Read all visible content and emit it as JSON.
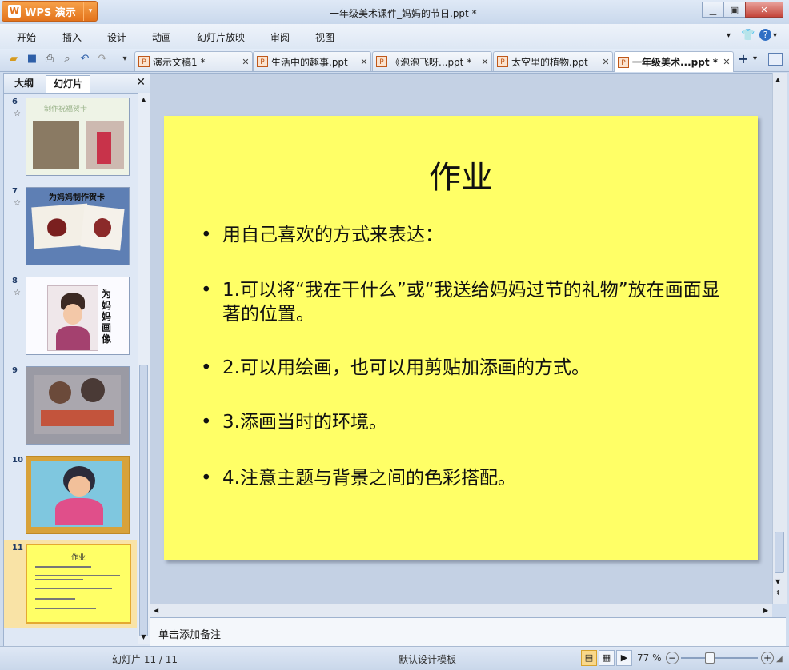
{
  "app": {
    "name": "WPS 演示",
    "doc_title": "一年级美术课件_妈妈的节日.ppt *"
  },
  "menu": [
    "开始",
    "插入",
    "设计",
    "动画",
    "幻灯片放映",
    "审阅",
    "视图"
  ],
  "tabs": [
    {
      "label": "演示文稿1 *"
    },
    {
      "label": "生活中的趣事.ppt"
    },
    {
      "label": "《泡泡飞呀...ppt *"
    },
    {
      "label": "太空里的植物.ppt"
    },
    {
      "label": "一年级美术...ppt *"
    }
  ],
  "left_pane": {
    "tab_outline": "大纲",
    "tab_slides": "幻灯片",
    "slides": [
      {
        "num": "6",
        "star": "☆",
        "caption": "制作祝福贺卡"
      },
      {
        "num": "7",
        "star": "☆",
        "caption": "为妈妈制作贺卡"
      },
      {
        "num": "8",
        "star": "☆",
        "caption": "为妈妈画像"
      },
      {
        "num": "9",
        "star": ""
      },
      {
        "num": "10",
        "star": ""
      },
      {
        "num": "11",
        "star": "",
        "caption": "作业"
      }
    ]
  },
  "slide": {
    "title": "作业",
    "bullets": [
      "用自己喜欢的方式来表达：",
      "1.可以将“我在干什么”或“我送给妈妈过节的礼物”放在画面显著的位置。",
      "2.可以用绘画，也可以用剪贴加添画的方式。",
      "3.添画当时的环境。",
      "4.注意主题与背景之间的色彩搭配。"
    ],
    "bg_color": "#ffff66"
  },
  "notes_placeholder": "单击添加备注",
  "status": {
    "slide_count": "幻灯片 11 / 11",
    "template": "默认设计模板",
    "zoom": "77 %"
  }
}
